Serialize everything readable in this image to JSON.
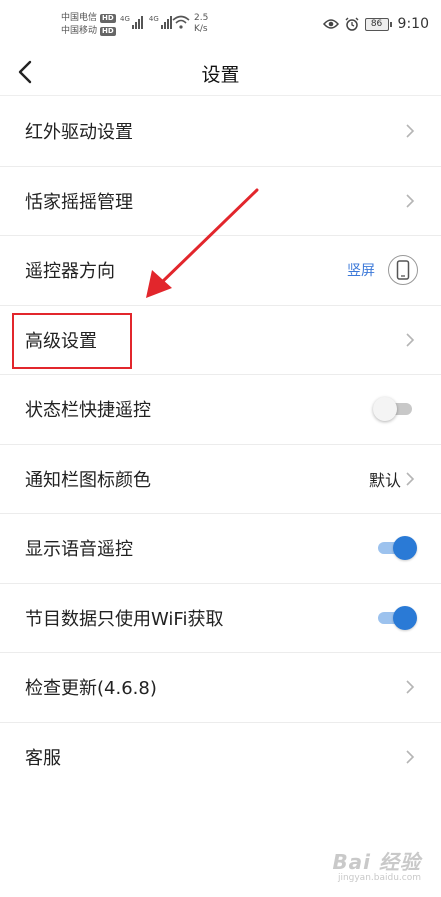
{
  "status_bar": {
    "carrier1": "中国电信",
    "carrier2": "中国移动",
    "hd_badge": "HD",
    "network_type": "4G",
    "speed_value": "2.5",
    "speed_unit": "K/s",
    "battery": "86",
    "time": "9:10"
  },
  "header": {
    "title": "设置"
  },
  "settings": [
    {
      "label": "红外驱动设置"
    },
    {
      "label": "恬家摇摇管理"
    },
    {
      "label": "遥控器方向",
      "value": "竖屏"
    },
    {
      "label": "高级设置"
    },
    {
      "label": "状态栏快捷遥控",
      "toggle": false
    },
    {
      "label": "通知栏图标颜色",
      "value": "默认"
    },
    {
      "label": "显示语音遥控",
      "toggle": true
    },
    {
      "label": "节目数据只使用WiFi获取",
      "toggle": true
    },
    {
      "label": "检查更新(4.6.8)"
    },
    {
      "label": "客服"
    }
  ],
  "watermark": {
    "brand": "Bai 经验",
    "url": "jingyan.baidu.com"
  },
  "colors": {
    "accent_blue": "#2a7ad6",
    "value_blue": "#3b78d8",
    "annotation_red": "#e2262c"
  }
}
